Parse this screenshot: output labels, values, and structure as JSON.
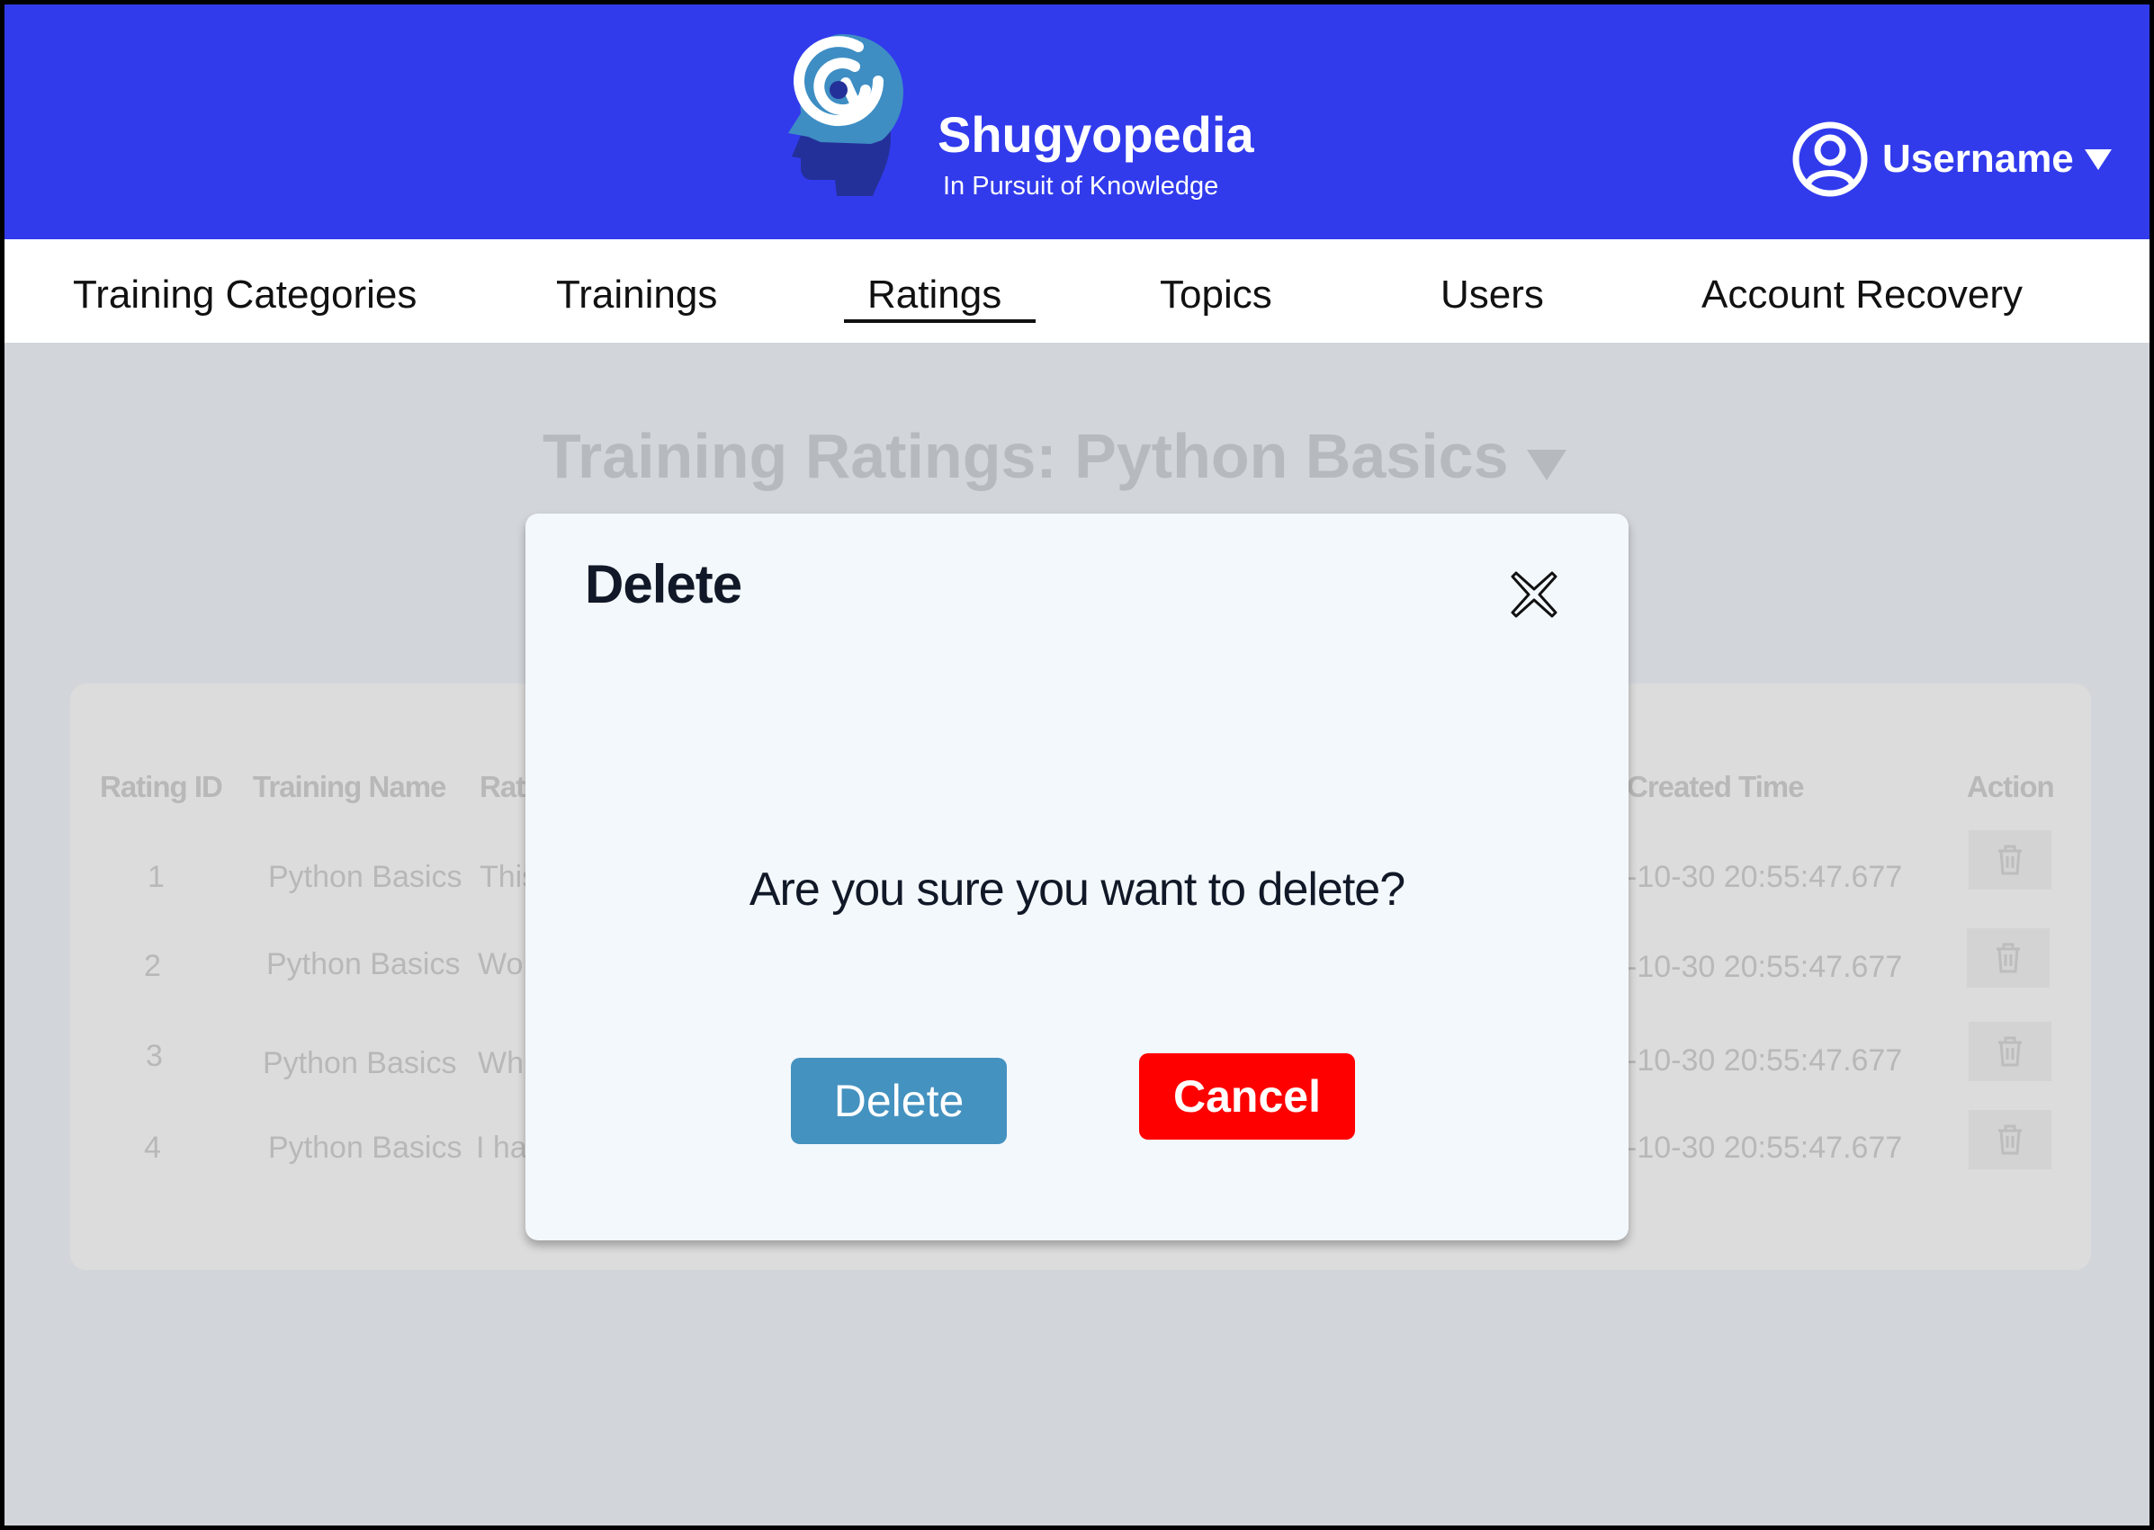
{
  "header": {
    "brand_name": "Shugyopedia",
    "tagline": "In Pursuit of Knowledge",
    "username": "Username",
    "logo_icon": "head-maze-icon",
    "avatar_icon": "user-circle-icon",
    "background_color": "#313bec"
  },
  "nav": {
    "items": [
      {
        "label": "Training Categories"
      },
      {
        "label": "Trainings"
      },
      {
        "label": "Ratings"
      },
      {
        "label": "Topics"
      },
      {
        "label": "Users"
      },
      {
        "label": "Account Recovery"
      }
    ],
    "active": "Ratings"
  },
  "page": {
    "title": "Training Ratings: Python Basics"
  },
  "table": {
    "columns": {
      "rating_id": "Rating ID",
      "training_name": "Training Name",
      "rating": "Rat",
      "created_time": "Created Time",
      "action": "Action"
    },
    "rows": [
      {
        "id": "1",
        "training": "Python Basics",
        "rating_text": "This",
        "created": "-10-30 20:55:47.677"
      },
      {
        "id": "2",
        "training": "Python Basics",
        "rating_text": "Wo",
        "created": "-10-30 20:55:47.677"
      },
      {
        "id": "3",
        "training": "Python Basics",
        "rating_text": "Wh",
        "created": "-10-30 20:55:47.677"
      },
      {
        "id": "4",
        "training": "Python Basics",
        "rating_text": "I ha",
        "created": "-10-30 20:55:47.677"
      }
    ],
    "action_icon": "trash-icon"
  },
  "modal": {
    "title": "Delete",
    "message": "Are you sure you want to delete?",
    "confirm_label": "Delete",
    "cancel_label": "Cancel",
    "confirm_color": "#4492c0",
    "cancel_color": "#ff0000"
  }
}
